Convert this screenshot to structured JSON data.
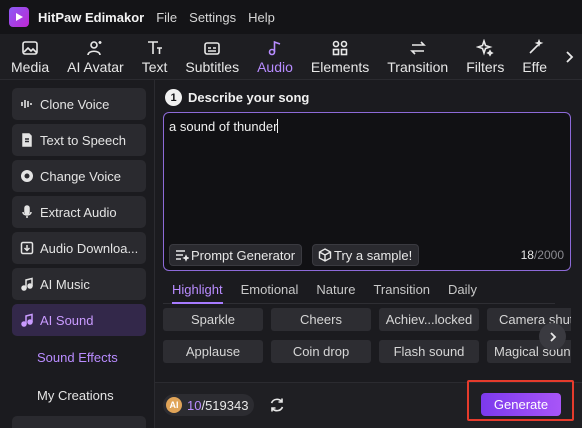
{
  "app": {
    "name": "HitPaw Edimakor",
    "menu": [
      "File",
      "Settings",
      "Help"
    ]
  },
  "toolbar": {
    "items": [
      {
        "label": "Media",
        "icon": "media-icon",
        "active": false
      },
      {
        "label": "AI Avatar",
        "icon": "avatar-icon",
        "active": false
      },
      {
        "label": "Text",
        "icon": "text-icon",
        "active": false
      },
      {
        "label": "Subtitles",
        "icon": "subtitles-icon",
        "active": false
      },
      {
        "label": "Audio",
        "icon": "music-note-icon",
        "active": true
      },
      {
        "label": "Elements",
        "icon": "elements-icon",
        "active": false
      },
      {
        "label": "Transition",
        "icon": "transition-icon",
        "active": false
      },
      {
        "label": "Filters",
        "icon": "filters-icon",
        "active": false
      },
      {
        "label": "Effe",
        "icon": "effects-icon",
        "active": false
      }
    ]
  },
  "sidebar": {
    "items": [
      {
        "label": "Clone Voice",
        "icon": "waveform-icon",
        "active": false
      },
      {
        "label": "Text to Speech",
        "icon": "document-audio-icon",
        "active": false
      },
      {
        "label": "Change Voice",
        "icon": "voice-changer-icon",
        "active": false
      },
      {
        "label": "Extract Audio",
        "icon": "microphone-icon",
        "active": false
      },
      {
        "label": "Audio Downloa...",
        "icon": "download-icon",
        "active": false
      },
      {
        "label": "AI Music",
        "icon": "music-icon",
        "active": false
      },
      {
        "label": "AI Sound",
        "icon": "sound-icon",
        "active": true
      }
    ],
    "sub_items": [
      {
        "label": "Sound Effects",
        "active": true
      },
      {
        "label": "My Creations",
        "active": false
      }
    ]
  },
  "main": {
    "step_number": "1",
    "step_title": "Describe your song",
    "prompt_value": "a sound of thunder",
    "prompt_generator_label": "Prompt Generator",
    "try_sample_label": "Try a sample!",
    "char_count": "18",
    "char_max": "/2000",
    "tabs": [
      {
        "label": "Highlight",
        "active": true
      },
      {
        "label": "Emotional",
        "active": false
      },
      {
        "label": "Nature",
        "active": false
      },
      {
        "label": "Transition",
        "active": false
      },
      {
        "label": "Daily",
        "active": false
      }
    ],
    "chips_row1": [
      "Sparkle",
      "Cheers",
      "Achiev...locked",
      "Camera shut"
    ],
    "chips_row2": [
      "Applause",
      "Coin drop",
      "Flash sound",
      "Magical soun"
    ]
  },
  "bottom": {
    "credits_used": "10",
    "credits_total": "/519343",
    "generate_label": "Generate"
  },
  "colors": {
    "accent": "#a855f7",
    "highlight_box": "#e53b2c"
  }
}
